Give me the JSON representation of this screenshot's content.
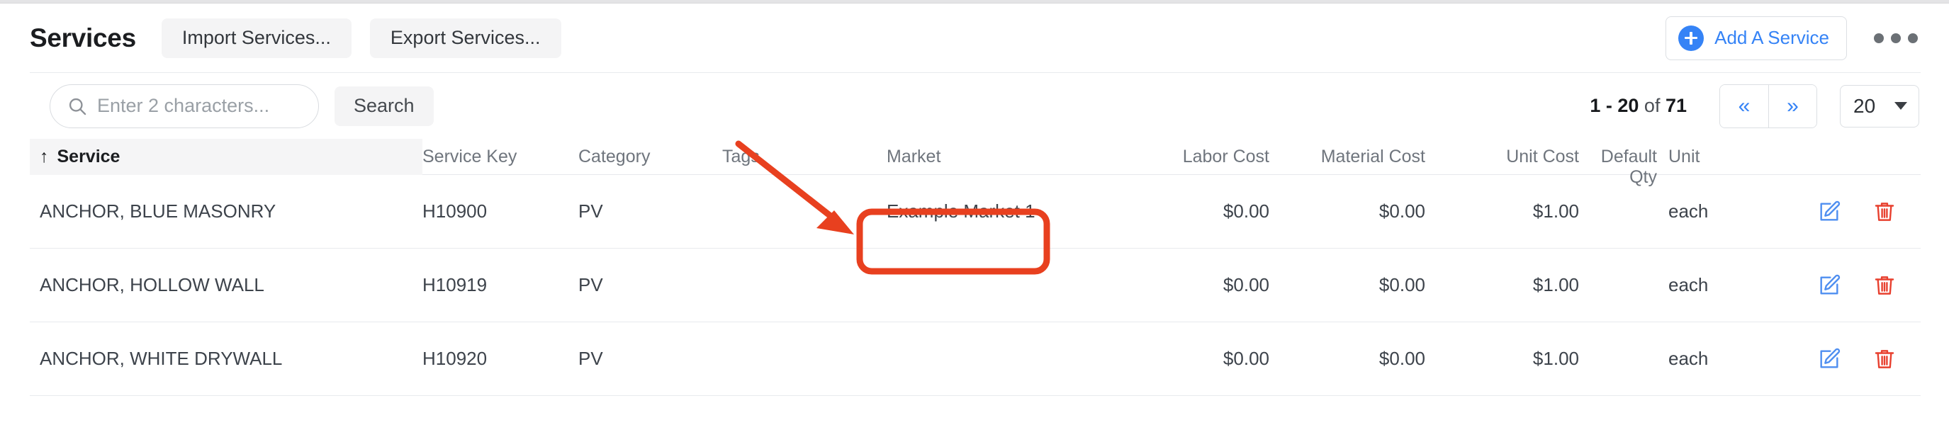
{
  "header": {
    "title": "Services",
    "import_label": "Import Services...",
    "export_label": "Export Services...",
    "add_label": "Add A Service",
    "overflow_icon": "kebab-horizontal-icon"
  },
  "toolbar": {
    "search_placeholder": "Enter 2 characters...",
    "search_value": "",
    "search_button": "Search",
    "range_prefix": "1 - 20",
    "range_middle": " of ",
    "range_total": "71",
    "prev_label": "«",
    "next_label": "»",
    "page_size": "20"
  },
  "table": {
    "sort_indicator": "↑",
    "columns": [
      {
        "key": "service",
        "label": "Service",
        "sorted": true
      },
      {
        "key": "service_key",
        "label": "Service Key",
        "sorted": false
      },
      {
        "key": "category",
        "label": "Category",
        "sorted": false
      },
      {
        "key": "tags",
        "label": "Tags",
        "sorted": false
      },
      {
        "key": "market",
        "label": "Market",
        "sorted": false
      },
      {
        "key": "labor_cost",
        "label": "Labor Cost",
        "sorted": false
      },
      {
        "key": "material_cost",
        "label": "Material Cost",
        "sorted": false
      },
      {
        "key": "unit_cost",
        "label": "Unit Cost",
        "sorted": false
      },
      {
        "key": "default_qty",
        "label": "Default Qty",
        "sorted": false
      },
      {
        "key": "unit",
        "label": "Unit",
        "sorted": false
      }
    ],
    "rows": [
      {
        "service": "ANCHOR, BLUE MASONRY",
        "service_key": "H10900",
        "category": "PV",
        "tags": "",
        "market": "Example Market 1",
        "labor_cost": "$0.00",
        "material_cost": "$0.00",
        "unit_cost": "$1.00",
        "default_qty": "",
        "unit": "each"
      },
      {
        "service": "ANCHOR, HOLLOW WALL",
        "service_key": "H10919",
        "category": "PV",
        "tags": "",
        "market": "",
        "labor_cost": "$0.00",
        "material_cost": "$0.00",
        "unit_cost": "$1.00",
        "default_qty": "",
        "unit": "each"
      },
      {
        "service": "ANCHOR, WHITE DRYWALL",
        "service_key": "H10920",
        "category": "PV",
        "tags": "",
        "market": "",
        "labor_cost": "$0.00",
        "material_cost": "$0.00",
        "unit_cost": "$1.00",
        "default_qty": "",
        "unit": "each"
      }
    ],
    "row_actions": {
      "edit_icon": "edit-pencil-square-icon",
      "delete_icon": "trash-icon"
    }
  },
  "annotation": {
    "color": "#e8401f",
    "arrow_icon": "arrow-pointer-icon",
    "highlight_icon": "rounded-rect-highlight"
  },
  "colors": {
    "accent_blue": "#3583f6",
    "delete_red": "#e8402f",
    "annotation_red": "#e8401f",
    "header_text": "#1b1d20",
    "muted_text": "#6f757d",
    "body_text": "#3d434b"
  }
}
